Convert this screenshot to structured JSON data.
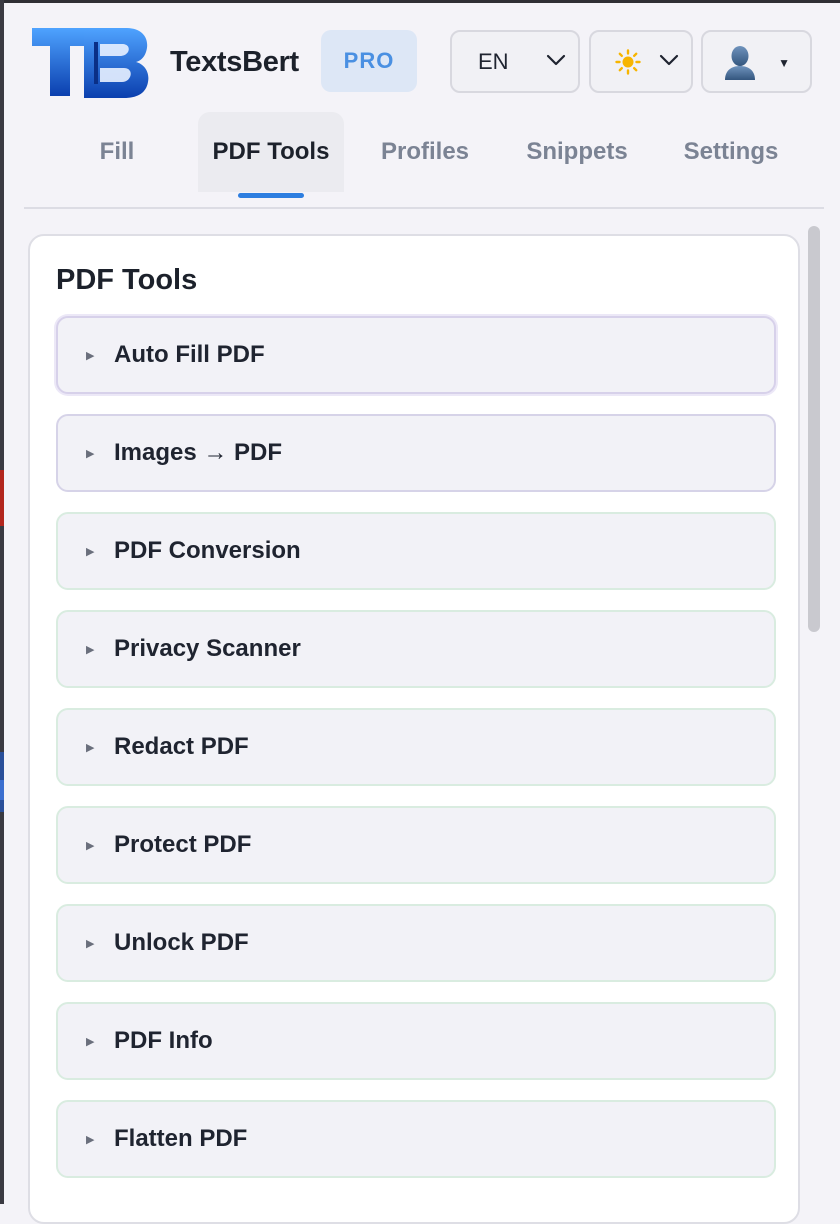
{
  "app": {
    "brand_name": "TextsBert",
    "plan_badge": "PRO"
  },
  "controls": {
    "language": "EN",
    "theme_icon": "sun-icon",
    "user_icon": "user-icon"
  },
  "tabs": [
    {
      "label": "Fill",
      "active": false
    },
    {
      "label": "PDF Tools",
      "active": true
    },
    {
      "label": "Profiles",
      "active": false
    },
    {
      "label": "Snippets",
      "active": false
    },
    {
      "label": "Settings",
      "active": false
    }
  ],
  "panel": {
    "title": "PDF Tools",
    "tools": [
      {
        "label": "Auto Fill PDF"
      },
      {
        "label": "Images → PDF"
      },
      {
        "label": "PDF Conversion"
      },
      {
        "label": "Privacy Scanner"
      },
      {
        "label": "Redact PDF"
      },
      {
        "label": "Protect PDF"
      },
      {
        "label": "Unlock PDF"
      },
      {
        "label": "PDF Info"
      },
      {
        "label": "Flatten PDF"
      }
    ]
  },
  "colors": {
    "accent": "#2d7ee0",
    "pro_text": "#4a90e2",
    "pro_bg": "#dde7f6"
  }
}
